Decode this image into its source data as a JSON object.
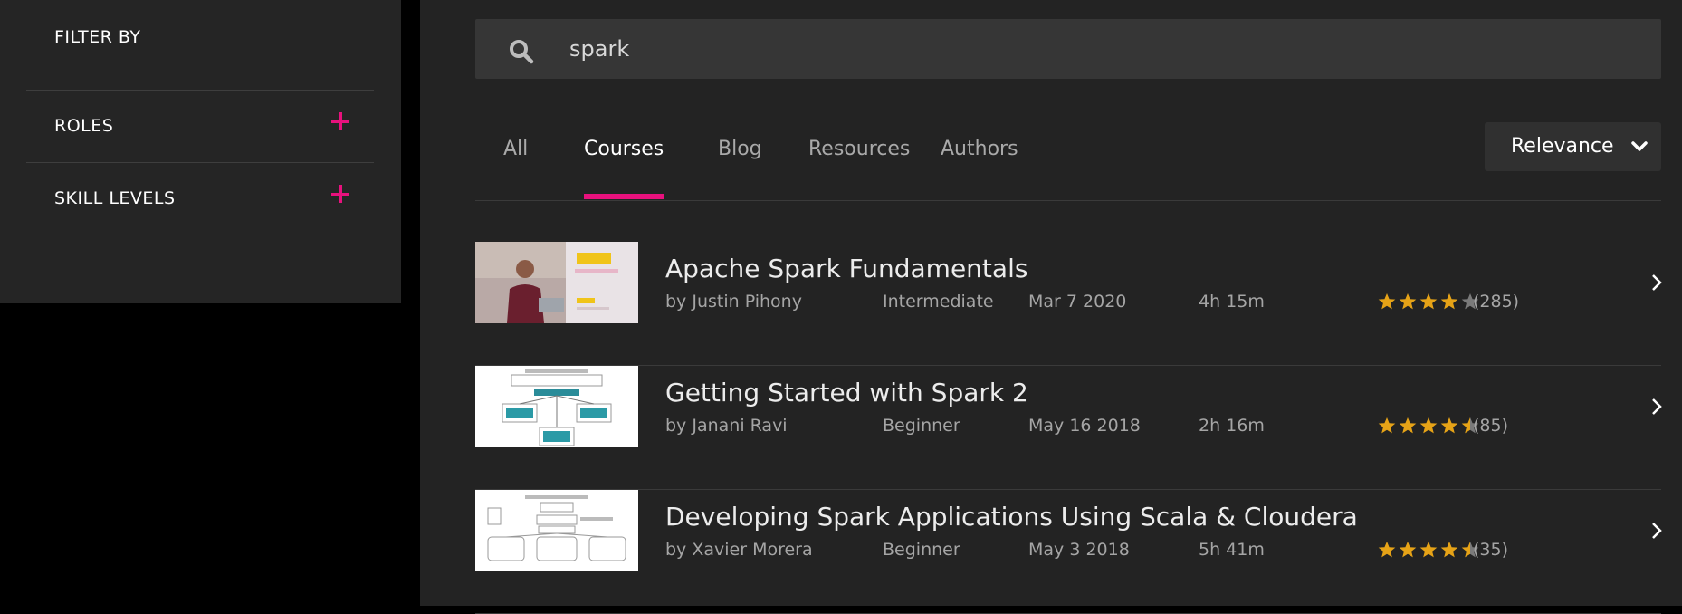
{
  "sidebar": {
    "title": "FILTER BY",
    "filters": [
      {
        "label": "ROLES"
      },
      {
        "label": "SKILL LEVELS"
      }
    ]
  },
  "search": {
    "value": "spark",
    "icon": "search-icon"
  },
  "tabs": [
    {
      "label": "All",
      "active": false
    },
    {
      "label": "Courses",
      "active": true
    },
    {
      "label": "Blog",
      "active": false
    },
    {
      "label": "Resources",
      "active": false
    },
    {
      "label": "Authors",
      "active": false
    }
  ],
  "sort": {
    "label": "Relevance"
  },
  "accent_color": "#e8117d",
  "star_color": "#e6a317",
  "courses": [
    {
      "title": "Apache Spark Fundamentals",
      "author": "by Justin Pihony",
      "level": "Intermediate",
      "date": "Mar 7 2020",
      "duration": "4h 15m",
      "rating": 4.0,
      "count": "(285)"
    },
    {
      "title": "Getting Started with Spark 2",
      "author": "by Janani Ravi",
      "level": "Beginner",
      "date": "May 16 2018",
      "duration": "2h 16m",
      "rating": 4.5,
      "count": "(85)"
    },
    {
      "title": "Developing Spark Applications Using Scala & Cloudera",
      "author": "by Xavier Morera",
      "level": "Beginner",
      "date": "May 3 2018",
      "duration": "5h 41m",
      "rating": 4.5,
      "count": "(35)"
    }
  ]
}
